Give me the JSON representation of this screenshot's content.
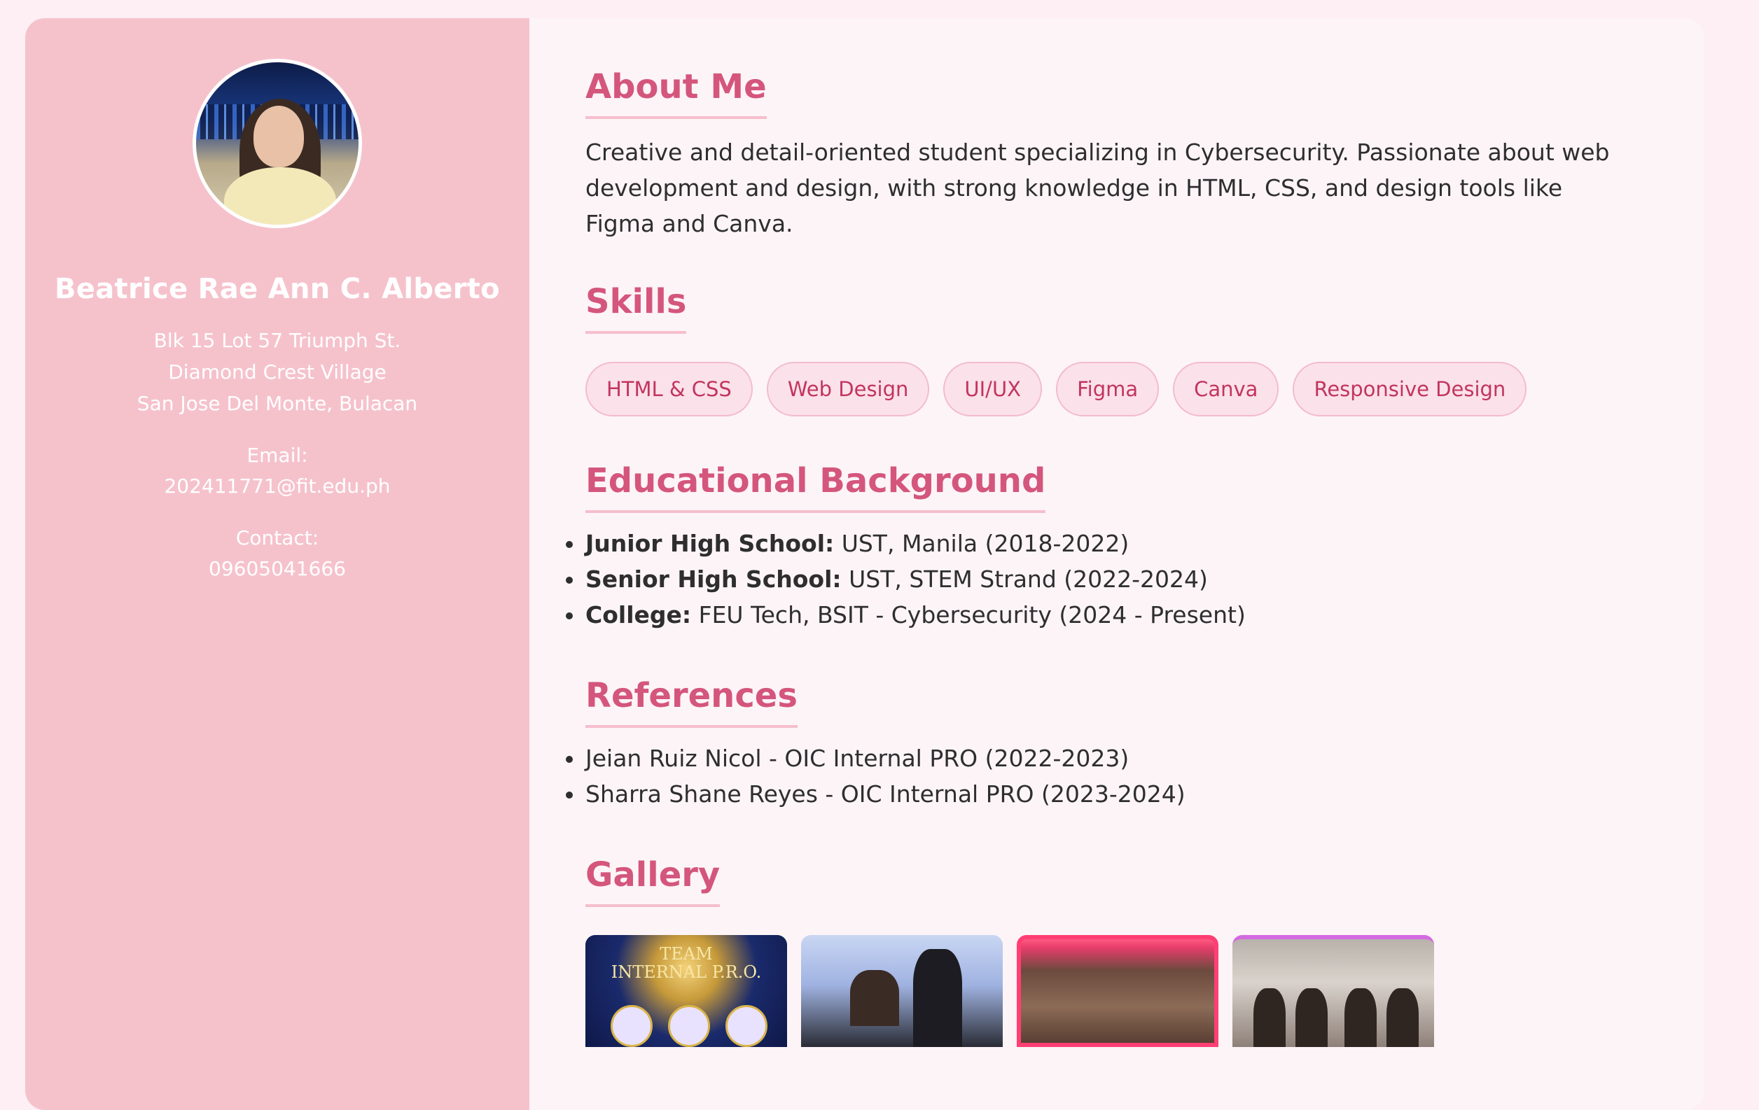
{
  "profile": {
    "name": "Beatrice Rae Ann C. Alberto",
    "address": [
      "Blk 15 Lot 57 Triumph St.",
      "Diamond Crest Village",
      "San Jose Del Monte, Bulacan"
    ],
    "email_label": "Email:",
    "email": "202411771@fit.edu.ph",
    "contact_label": "Contact:",
    "contact": "09605041666"
  },
  "about": {
    "title": "About Me",
    "text": "Creative and detail-oriented student specializing in Cybersecurity. Passionate about web development and design, with strong knowledge in HTML, CSS, and design tools like Figma and Canva."
  },
  "skills": {
    "title": "Skills",
    "items": [
      "HTML & CSS",
      "Web Design",
      "UI/UX",
      "Figma",
      "Canva",
      "Responsive Design"
    ]
  },
  "education": {
    "title": "Educational Background",
    "items": [
      {
        "level": "Junior High School:",
        "detail": " UST, Manila (2018-2022)"
      },
      {
        "level": "Senior High School:",
        "detail": " UST, STEM Strand (2022-2024)"
      },
      {
        "level": "College:",
        "detail": " FEU Tech, BSIT - Cybersecurity (2024 - Present)"
      }
    ]
  },
  "references": {
    "title": "References",
    "items": [
      "Jeian Ruiz Nicol - OIC Internal PRO (2022-2023)",
      "Sharra Shane Reyes - OIC Internal PRO (2023-2024)"
    ]
  },
  "gallery": {
    "title": "Gallery",
    "photo1_text": [
      "TEAM",
      "INTERNAL P.R.O."
    ]
  },
  "colors": {
    "sidebar": "#f5c2cc",
    "accent": "#d4567c",
    "pill_bg": "#fbe1ea",
    "page_bg": "#fdeff3"
  }
}
